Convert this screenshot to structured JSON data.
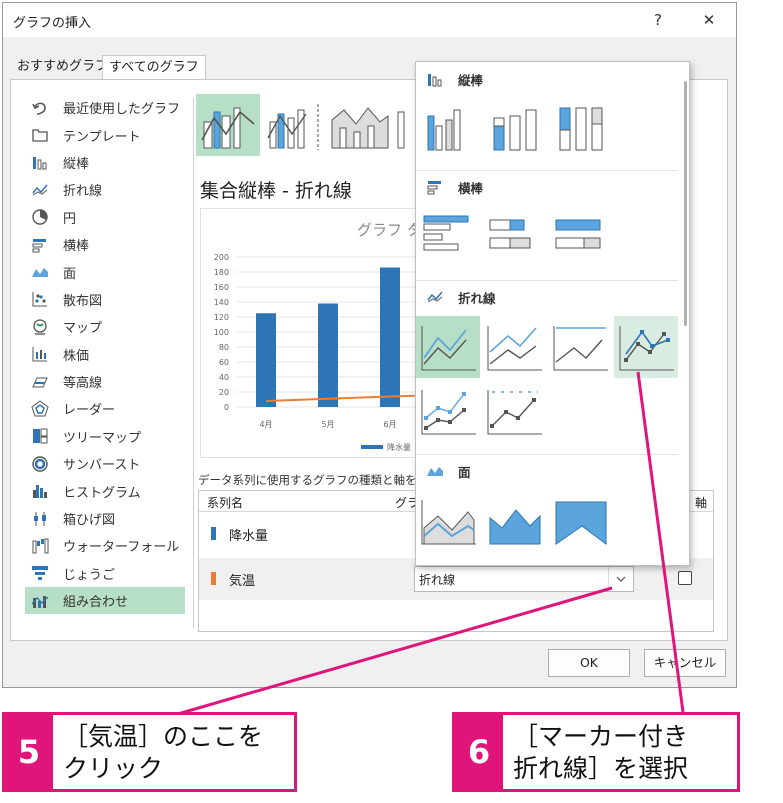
{
  "dialog": {
    "title": "グラフの挿入",
    "help": "?",
    "close": "✕",
    "tabs": [
      "おすすめグラフ",
      "すべてのグラフ"
    ],
    "categories": [
      "最近使用したグラフ",
      "テンプレート",
      "縦棒",
      "折れ線",
      "円",
      "横棒",
      "面",
      "散布図",
      "マップ",
      "株価",
      "等高線",
      "レーダー",
      "ツリーマップ",
      "サンバースト",
      "ヒストグラム",
      "箱ひげ図",
      "ウォーターフォール",
      "じょうご",
      "組み合わせ"
    ],
    "selected_category": "組み合わせ",
    "combo_title": "集合縦棒 - 折れ線",
    "preview": {
      "chart_title": "グラフ タ",
      "legend_label": "降水量"
    },
    "series_caption": "データ系列に使用するグラフの種類と軸を",
    "series_header": {
      "name": "系列名",
      "type": "グラ",
      "axis": "軸"
    },
    "series": [
      {
        "name": "降水量",
        "color": "#2e75b6"
      },
      {
        "name": "気温",
        "color": "#ed7d31",
        "chart_type": "折れ線"
      }
    ],
    "ok": "OK",
    "cancel": "キャンセル"
  },
  "chart_data": {
    "type": "bar",
    "title": "グラフ タ",
    "categories": [
      "4月",
      "5月",
      "6月"
    ],
    "ylim": [
      0,
      200
    ],
    "yticks": [
      0,
      20,
      40,
      60,
      80,
      100,
      120,
      140,
      160,
      180,
      200
    ],
    "series": [
      {
        "name": "降水量",
        "values": [
          125,
          138,
          186
        ]
      },
      {
        "values": [
          8,
          11,
          14
        ]
      }
    ]
  },
  "dropdown": {
    "sections": [
      "縦棒",
      "横棒",
      "折れ線",
      "面"
    ]
  },
  "callouts": [
    {
      "num": "5",
      "line1": "［気温］のここを",
      "line2": "クリック"
    },
    {
      "num": "6",
      "line1": "［マーカー付き",
      "line2": "折れ線］を選択"
    }
  ]
}
